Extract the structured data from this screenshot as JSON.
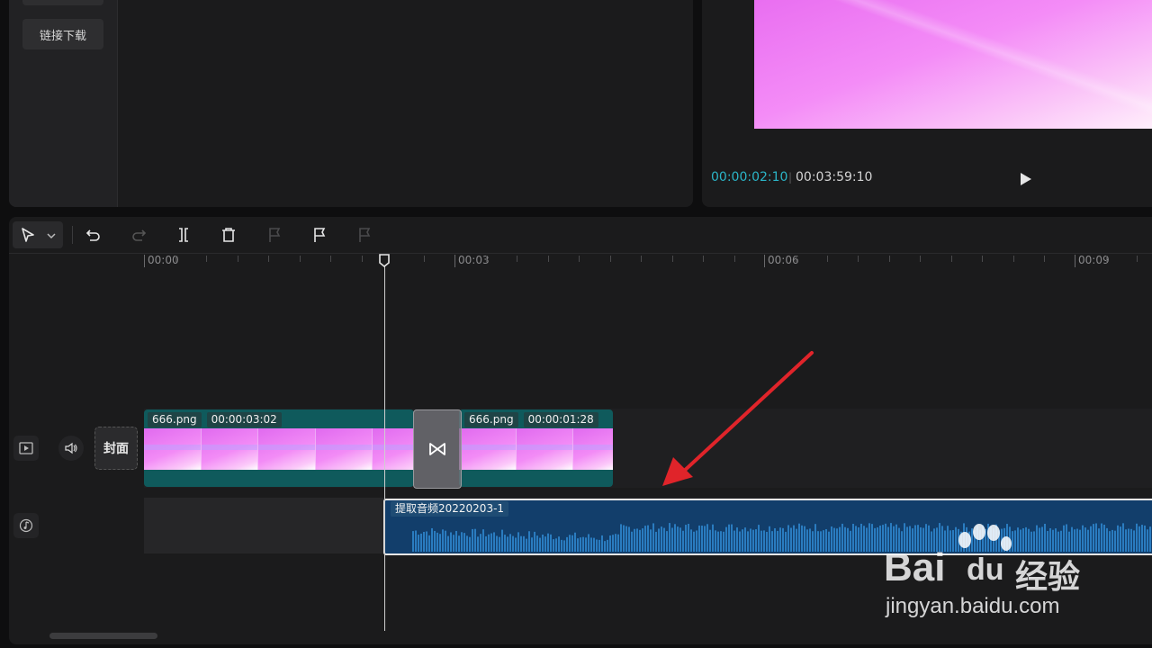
{
  "media": {
    "link_download_label": "链接下载"
  },
  "preview": {
    "current_time": "00:00:02:10",
    "separator": "|",
    "total_time": "00:03:59:10",
    "current_time_color": "#2bb5c7"
  },
  "toolbar": {
    "icons": [
      "select-cursor-icon",
      "dropdown-icon",
      "undo-icon",
      "redo-icon",
      "split-icon",
      "delete-icon",
      "freeze-icon",
      "flag-icon",
      "unflag-icon"
    ]
  },
  "ruler": {
    "labels": [
      "00:00",
      "00:03",
      "00:06",
      "00:09"
    ]
  },
  "tracks": {
    "cover_label": "封面",
    "video_clips": [
      {
        "name": "666.png",
        "duration": "00:00:03:02"
      },
      {
        "name": "666.png",
        "duration": "00:00:01:28"
      }
    ],
    "audio_clip": {
      "name": "提取音频20220203-1"
    }
  },
  "watermark": {
    "brand": "Bai",
    "brand2": "du",
    "product": "经验",
    "url": "jingyan.baidu.com"
  },
  "colors": {
    "accent": "#2bb5c7",
    "video_clip": "#0f5a5c",
    "audio_clip": "#123e6b",
    "arrow": "#e0242a"
  }
}
